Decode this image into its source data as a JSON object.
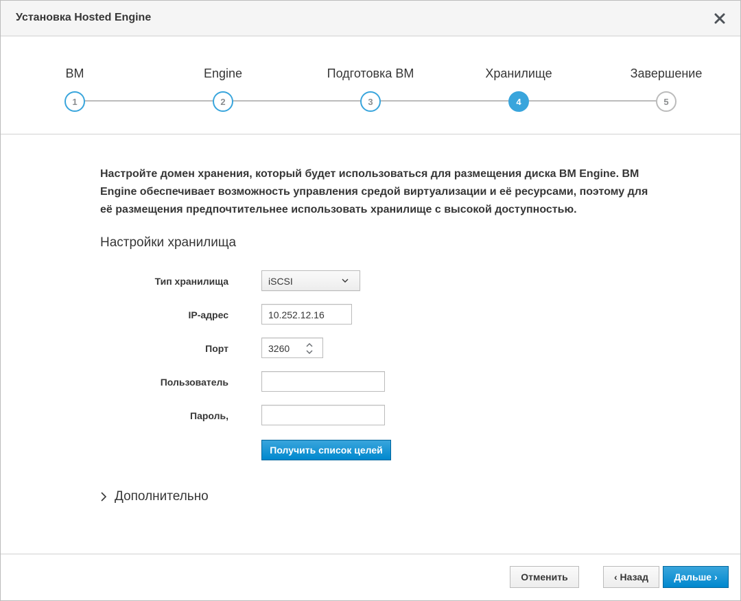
{
  "dialog": {
    "title": "Установка Hosted Engine",
    "close_icon": "close-icon"
  },
  "wizard": {
    "steps": [
      {
        "label": "ВМ",
        "number": "1",
        "state": "done"
      },
      {
        "label": "Engine",
        "number": "2",
        "state": "done"
      },
      {
        "label": "Подготовка ВМ",
        "number": "3",
        "state": "done"
      },
      {
        "label": "Хранилище",
        "number": "4",
        "state": "active"
      },
      {
        "label": "Завершение",
        "number": "5",
        "state": "future"
      }
    ]
  },
  "content": {
    "intro_lines": [
      "Настройте домен хранения, который будет использоваться для размещения диска ВМ Engine. ВМ",
      "Engine обеспечивает возможность управления средой виртуализации и её ресурсами, поэтому для",
      "её размещения предпочтительнее использовать хранилище с высокой доступностью."
    ],
    "section_title": "Настройки хранилища",
    "form": {
      "storage_type_label": "Тип хранилища",
      "storage_type_value": "iSCSI",
      "ip_label": "IP-адрес",
      "ip_value": "10.252.12.16",
      "port_label": "Порт",
      "port_value": "3260",
      "user_label": "Пользователь",
      "user_value": "",
      "password_label": "Пароль,",
      "password_value": "",
      "retrieve_button": "Получить список целей"
    },
    "advanced_label": "Дополнительно"
  },
  "footer": {
    "cancel": "Отменить",
    "back": "Назад",
    "next": "Дальше"
  },
  "colors": {
    "accent": "#39a5dc",
    "primary_button": "#0088ce",
    "border": "#bbbbbb",
    "text": "#363636"
  }
}
